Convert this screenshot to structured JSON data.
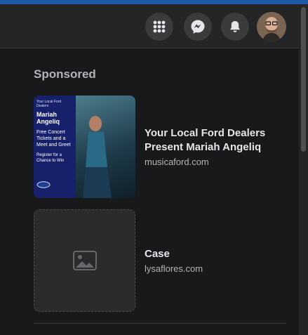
{
  "header": {
    "icons": [
      "grid-menu-icon",
      "messenger-icon",
      "bell-icon"
    ],
    "avatar": "user-avatar"
  },
  "sponsored": {
    "title": "Sponsored",
    "ads": [
      {
        "title": "Your Local Ford Dealers Present Mariah Angeliq",
        "url": "musicaford.com",
        "image": {
          "kicker": "Your Local Ford Dealers",
          "headline": "Mariah Angeliq",
          "body": "Free Concert Tickets and a Meet and Greet",
          "cta": "Register for a Chance to Win"
        }
      },
      {
        "title": "Case",
        "url": "lysaflores.com"
      }
    ]
  }
}
